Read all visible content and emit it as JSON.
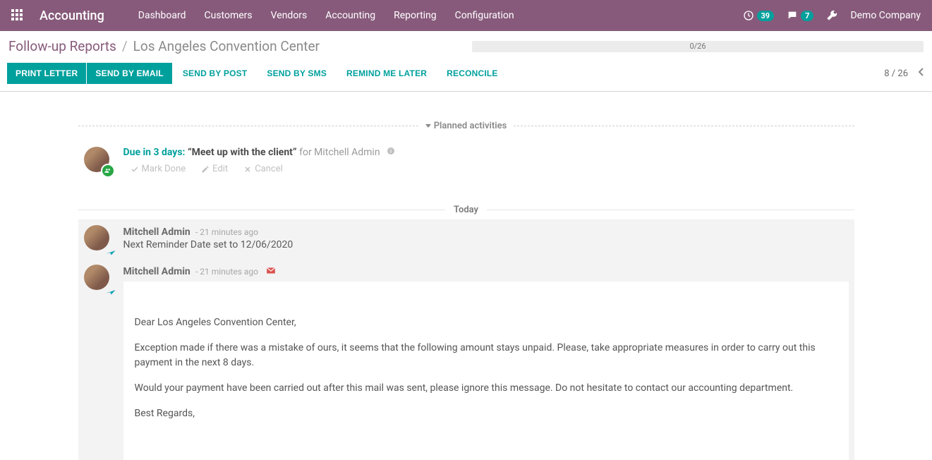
{
  "topnav": {
    "brand": "Accounting",
    "menu": [
      "Dashboard",
      "Customers",
      "Vendors",
      "Accounting",
      "Reporting",
      "Configuration"
    ],
    "activities_count": "39",
    "messages_count": "7",
    "company": "Demo Company"
  },
  "breadcrumb": {
    "link": "Follow-up Reports",
    "sep": "/",
    "current": "Los Angeles Convention Center"
  },
  "progress": "0/26",
  "actions": {
    "print_letter": "Print Letter",
    "send_email": "Send By Email",
    "send_post": "Send By Post",
    "send_sms": "Send By SMS",
    "remind_later": "Remind Me Later",
    "reconcile": "Reconcile"
  },
  "pager": "8 / 26",
  "planned_activities_label": "Planned activities",
  "activity": {
    "due": "Due in 3 days:",
    "title": "“Meet up with the client”",
    "for": "for Mitchell Admin",
    "mark_done": "Mark Done",
    "edit": "Edit",
    "cancel": "Cancel"
  },
  "today_label": "Today",
  "messages": [
    {
      "author": "Mitchell Admin",
      "ago": "- 21 minutes ago",
      "note": "Next Reminder Date set to 12/06/2020"
    },
    {
      "author": "Mitchell Admin",
      "ago": "- 21 minutes ago"
    }
  ],
  "letter": {
    "p1": "Dear Los Angeles Convention Center,",
    "p2": "Exception made if there was a mistake of ours, it seems that the following amount stays unpaid. Please, take appropriate measures in order to carry out this payment in the next 8 days.",
    "p3": "Would your payment have been carried out after this mail was sent, please ignore this message. Do not hesitate to contact our accounting department.",
    "p4": "Best Regards,"
  }
}
